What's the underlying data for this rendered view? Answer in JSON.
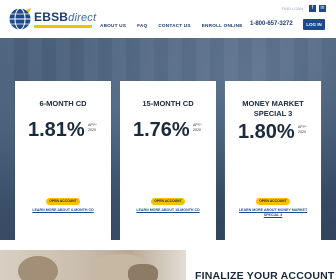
{
  "header": {
    "logo": {
      "brand": "EBSB",
      "suffix": "direct"
    },
    "top_link": "FIND LOAN",
    "social": [
      "f",
      "in"
    ],
    "nav": [
      "ABOUT US",
      "FAQ",
      "CONTACT US",
      "ENROLL ONLINE"
    ],
    "phone": "1-800-657-3272",
    "login_label": "LOG IN"
  },
  "cards": [
    {
      "title": "6-MONTH CD",
      "rate": "1.81%",
      "apy": [
        "APY*",
        "2020"
      ],
      "button": "OPEN ACCOUNT",
      "link": "LEARN MORE ABOUT 6-MONTH CD"
    },
    {
      "title": "15-MONTH CD",
      "rate": "1.76%",
      "apy": [
        "APY*",
        "2020"
      ],
      "button": "OPEN ACCOUNT",
      "link": "LEARN MORE ABOUT 15-MONTH CD"
    },
    {
      "title": "MONEY MARKET SPECIAL 3",
      "rate": "1.80%",
      "apy": [
        "APY*",
        "2020"
      ],
      "button": "OPEN ACCOUNT",
      "link": "LEARN MORE ABOUT MONEY MARKET SPECIAL 3"
    }
  ],
  "bottom": {
    "heading": "FINALIZE YOUR ACCOUNT"
  },
  "colors": {
    "brand_blue": "#1e4a8c",
    "accent_yellow": "#f2c200",
    "hero_bg": "#3f556f"
  },
  "icons": {
    "logo": "globe-icon",
    "scroll": "chevron-down-icon"
  }
}
